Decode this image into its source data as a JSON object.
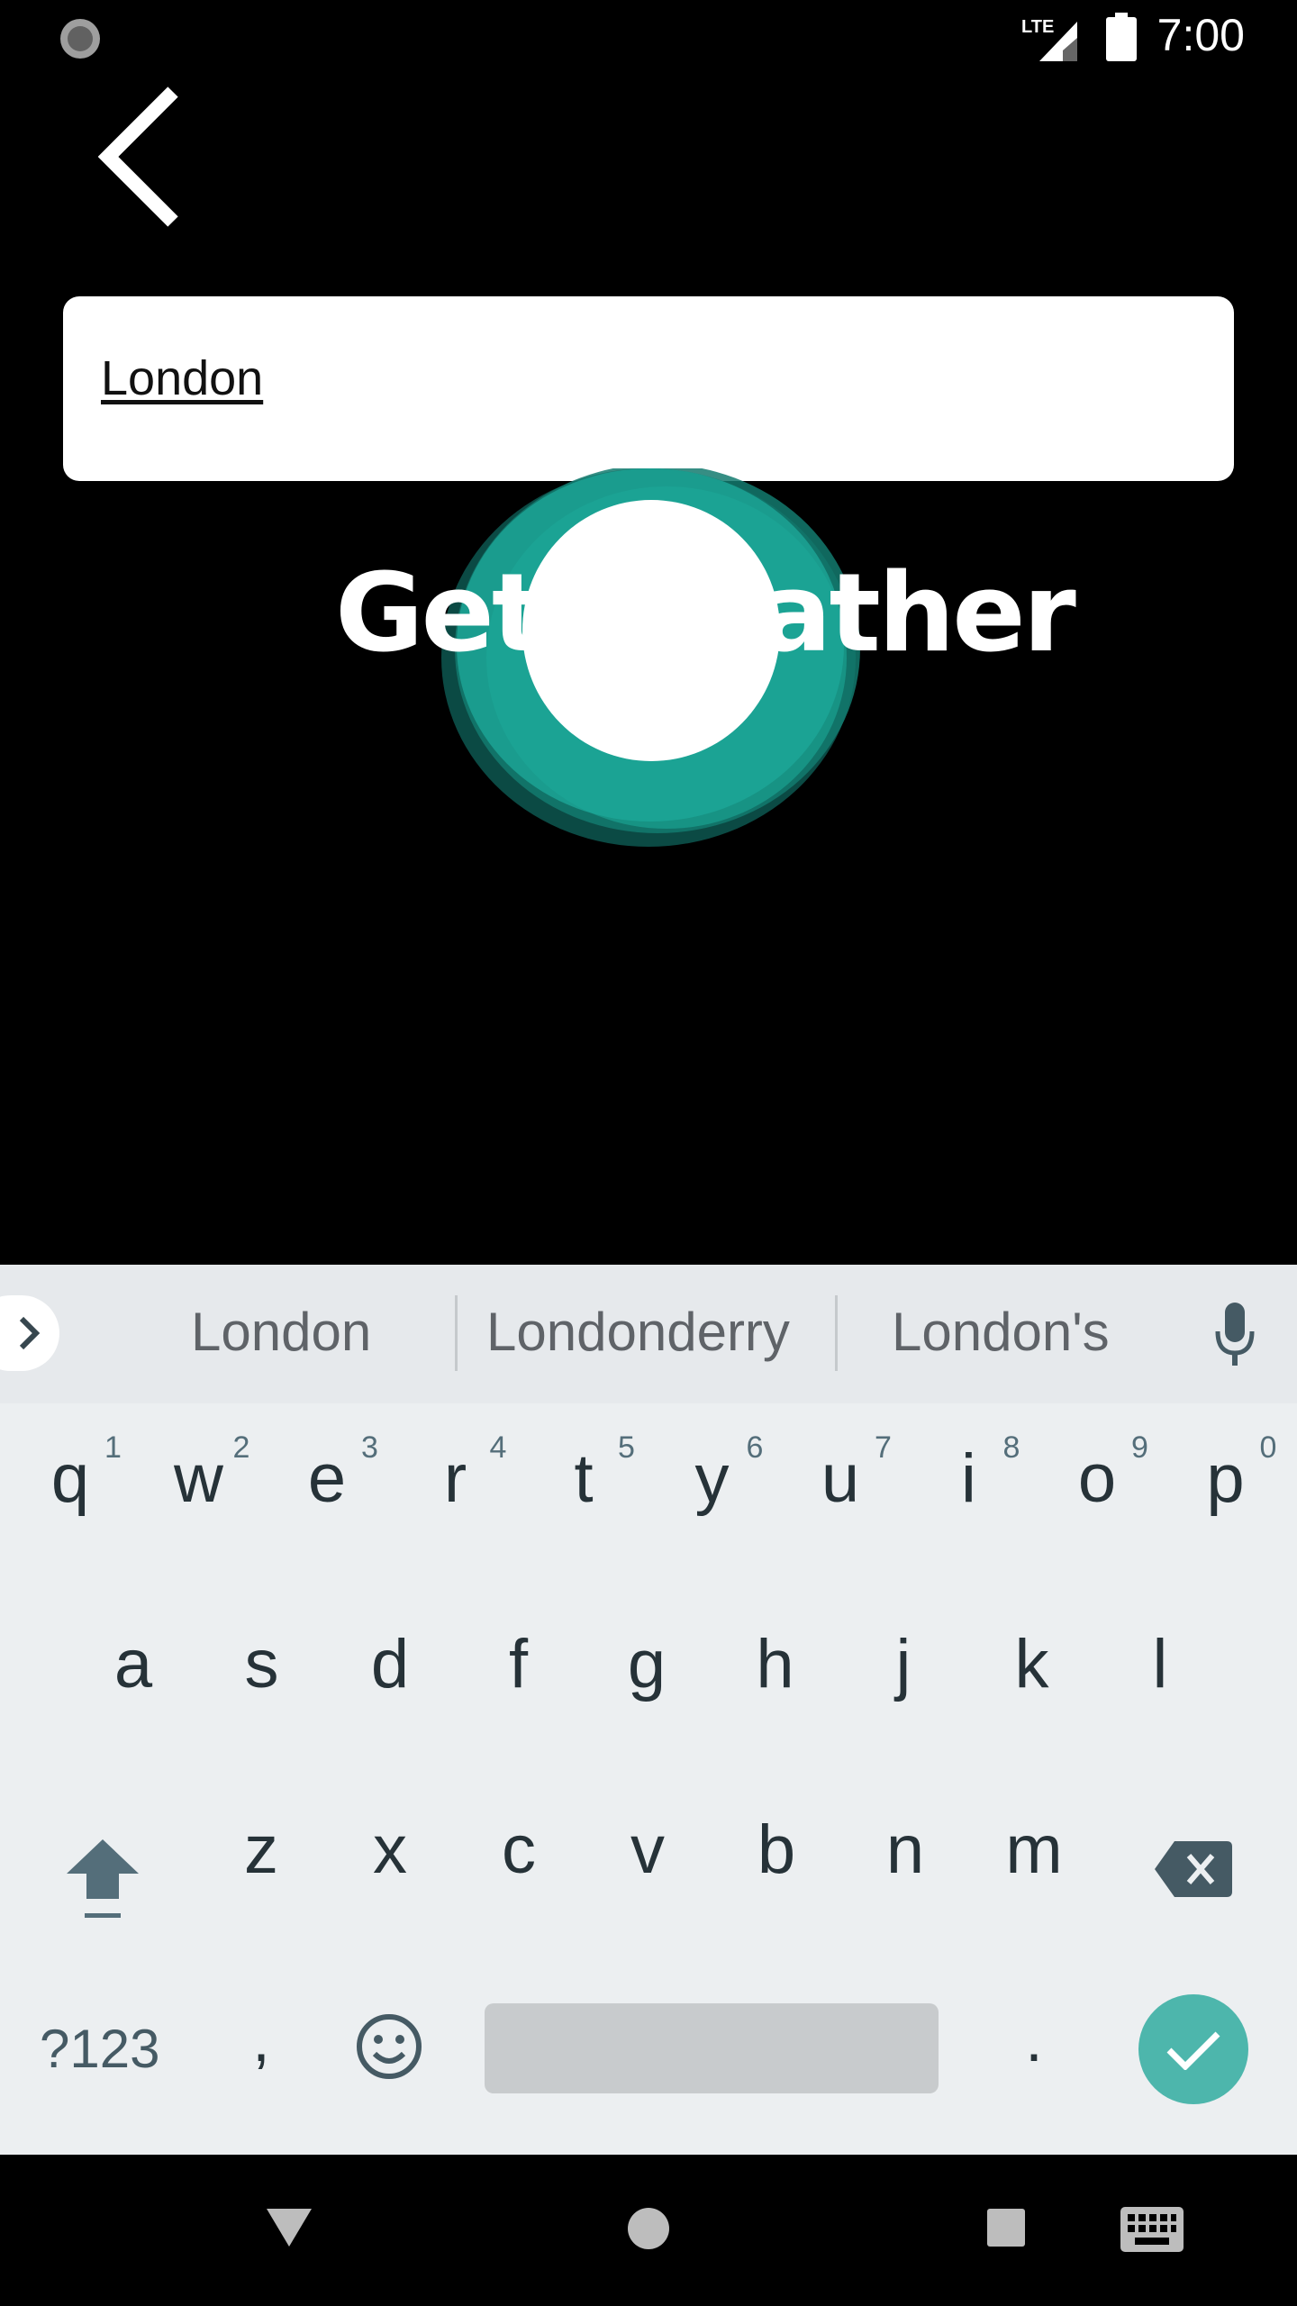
{
  "status_bar": {
    "time": "7:00",
    "network": "LTE"
  },
  "search": {
    "value": "London",
    "placeholder": ""
  },
  "logo": {
    "text": "Get Weather",
    "accent_color": "#1aa394"
  },
  "keyboard": {
    "suggestions": [
      "London",
      "Londonderry",
      "London's"
    ],
    "row1": [
      {
        "k": "q",
        "h": "1"
      },
      {
        "k": "w",
        "h": "2"
      },
      {
        "k": "e",
        "h": "3"
      },
      {
        "k": "r",
        "h": "4"
      },
      {
        "k": "t",
        "h": "5"
      },
      {
        "k": "y",
        "h": "6"
      },
      {
        "k": "u",
        "h": "7"
      },
      {
        "k": "i",
        "h": "8"
      },
      {
        "k": "o",
        "h": "9"
      },
      {
        "k": "p",
        "h": "0"
      }
    ],
    "row2": [
      "a",
      "s",
      "d",
      "f",
      "g",
      "h",
      "j",
      "k",
      "l"
    ],
    "row3": [
      "z",
      "x",
      "c",
      "v",
      "b",
      "n",
      "m"
    ],
    "symbols_label": "?123",
    "comma": ",",
    "period": ".",
    "enter_color": "#4db6ac"
  },
  "icons": {
    "back": "back-arrow-icon",
    "mic": "microphone-icon",
    "shift": "shift-icon",
    "backspace": "backspace-icon",
    "emoji": "emoji-icon",
    "enter": "check-icon",
    "nav_back": "nav-back-icon",
    "nav_home": "nav-home-icon",
    "nav_recents": "nav-recents-icon",
    "nav_keyboard": "keyboard-switch-icon"
  }
}
